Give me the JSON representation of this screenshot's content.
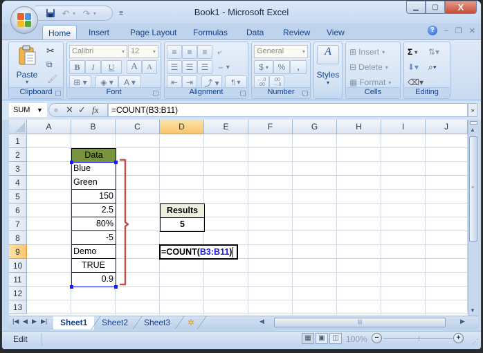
{
  "window": {
    "title": "Book1 - Microsoft Excel",
    "controls": {
      "minimize": "—",
      "restore": "▢",
      "close": "X"
    }
  },
  "quick_access": {
    "save_icon": "save-icon",
    "undo_icon": "undo-icon",
    "redo_icon": "redo-icon",
    "customize_icon": "customize-icon"
  },
  "ribbon_tabs": [
    "Home",
    "Insert",
    "Page Layout",
    "Formulas",
    "Data",
    "Review",
    "View"
  ],
  "active_ribbon_tab": "Home",
  "ribbon": {
    "clipboard": {
      "label": "Clipboard",
      "paste": "Paste"
    },
    "font": {
      "label": "Font",
      "font_name": "Calibri",
      "font_size": "12",
      "bold": "B",
      "italic": "I",
      "underline": "U",
      "grow": "A",
      "shrink": "A"
    },
    "alignment": {
      "label": "Alignment"
    },
    "number": {
      "label": "Number",
      "format": "General",
      "currency": "$",
      "percent": "%",
      "comma": ",",
      "inc_decimal": "←.0\n.00",
      "dec_decimal": ".00\n→.0"
    },
    "styles": {
      "label": "Styles"
    },
    "cells": {
      "label": "Cells",
      "insert": "Insert",
      "delete": "Delete",
      "format": "Format"
    },
    "editing": {
      "label": "Editing",
      "sum": "Σ"
    }
  },
  "formula_bar": {
    "name_box": "SUM",
    "formula": "=COUNT(B3:B11)",
    "fx": "fx"
  },
  "columns": [
    "A",
    "B",
    "C",
    "D",
    "E",
    "F",
    "G",
    "H",
    "I",
    "J"
  ],
  "selected_column": "D",
  "rows": [
    "1",
    "2",
    "3",
    "4",
    "5",
    "6",
    "7",
    "8",
    "9",
    "10",
    "11",
    "12",
    "13"
  ],
  "selected_row": "9",
  "cells": {
    "B2": "Data",
    "B3": "Blue",
    "B4": "Green",
    "B5": "150",
    "B6": "2.5",
    "B7": "80%",
    "B8": "-5",
    "B9": "Demo",
    "B10": "TRUE",
    "B11": "0.9",
    "D6": "Results",
    "D7": "5"
  },
  "editing_cell": {
    "address": "D9",
    "prefix": "=COUNT(",
    "reference": "B3:B11",
    "suffix": ")"
  },
  "highlighted_range": "B3:B11",
  "colors": {
    "data_header_fill": "#77933C",
    "results_header_fill": "#EBF1DE",
    "range_highlight": "#1A1AFF",
    "bracket": "#C0504D",
    "selected_header": "#F8C66F"
  },
  "sheet_tabs": [
    "Sheet1",
    "Sheet2",
    "Sheet3"
  ],
  "active_sheet": "Sheet1",
  "status_bar": {
    "mode": "Edit",
    "zoom": "100%"
  }
}
